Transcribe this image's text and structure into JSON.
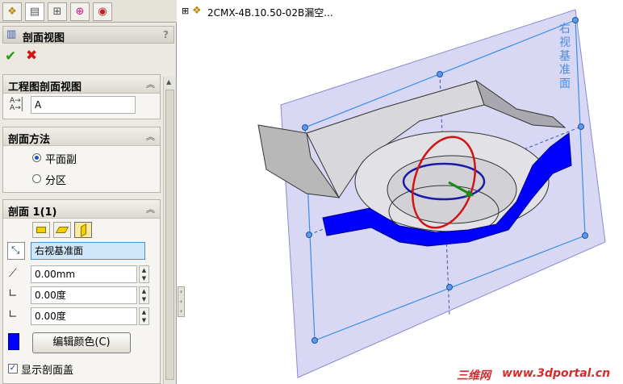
{
  "tree": {
    "expand": "⊞",
    "part_name": "2CMX-4B.10.50-02B漏空..."
  },
  "property_manager": {
    "title": "剖面视图",
    "help": "?",
    "ok": "✔",
    "cancel": "✖"
  },
  "groups": {
    "drawing_section": {
      "title": "工程图剖面视图",
      "label_value": "A"
    },
    "section_method": {
      "title": "剖面方法",
      "options": [
        "平面副",
        "分区"
      ],
      "selected": "平面副"
    },
    "section1": {
      "title": "剖面 1(1)",
      "plane_value": "右视基准面",
      "offset_value": "0.00mm",
      "angle1_value": "0.00度",
      "angle2_value": "0.00度",
      "edit_color_button": "编辑颜色(C)",
      "show_cap_label": "显示剖面盖",
      "show_cap_checked": true,
      "color_swatch": "#0000ff"
    }
  },
  "viewport": {
    "plane_label": "右视基准面",
    "plane_color": "#c8c8f0",
    "section_fill_color": "#0000ff"
  },
  "watermark": {
    "part1": "三维网",
    "part2": "www.3dportal.cn"
  }
}
